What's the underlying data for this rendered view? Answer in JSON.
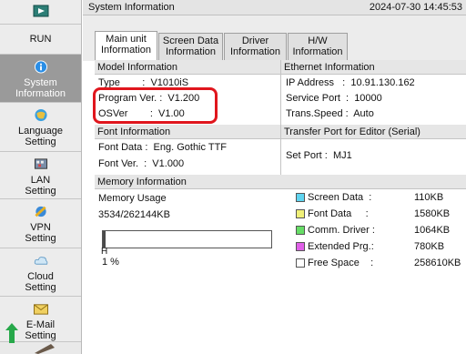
{
  "header": {
    "title": "System Information",
    "datetime": "2024-07-30 14:45:53"
  },
  "sidebar": {
    "items": [
      {
        "label": "",
        "icon": "top-screen-icon"
      },
      {
        "label": "RUN",
        "icon": ""
      },
      {
        "label": "System\nInformation",
        "icon": "info-icon"
      },
      {
        "label": "Language\nSetting",
        "icon": "language-icon"
      },
      {
        "label": "LAN\nSetting",
        "icon": "lan-icon"
      },
      {
        "label": "VPN\nSetting",
        "icon": "vpn-icon"
      },
      {
        "label": "Cloud\nSetting",
        "icon": "cloud-icon"
      },
      {
        "label": "E-Mail\nSetting",
        "icon": "email-icon"
      }
    ]
  },
  "tabs": [
    {
      "label": "Main unit\nInformation",
      "active": true
    },
    {
      "label": "Screen Data\nInformation",
      "active": false
    },
    {
      "label": "Driver\nInformation",
      "active": false
    },
    {
      "label": "H/W\nInformation",
      "active": false
    }
  ],
  "model": {
    "heading": "Model Information",
    "type": "Type        :  V1010iS",
    "program": "Program Ver. :  V1.200",
    "os": "OSVer        :  V1.00"
  },
  "ethernet": {
    "heading": "Ethernet Information",
    "ip": "IP Address   :  10.91.130.162",
    "port": "Service Port  :  10000",
    "speed": "Trans.Speed :  Auto"
  },
  "font": {
    "heading": "Font Information",
    "data": "Font Data :  Eng. Gothic TTF",
    "ver": "Font Ver.  :  V1.000"
  },
  "transfer": {
    "heading": "Transfer Port for Editor (Serial)",
    "port": "Set Port :  MJ1"
  },
  "memory": {
    "heading": "Memory Information",
    "usage_label": "Memory Usage",
    "usage_value": "3534/262144KB",
    "usage_fraction": 0.013,
    "bar_tick": "H",
    "percent": "1 %",
    "legend": [
      {
        "label": "Screen Data  :",
        "value": "110KB",
        "color": "#5fd4f0"
      },
      {
        "label": "Font Data     :",
        "value": "1580KB",
        "color": "#f0f078"
      },
      {
        "label": "Comm. Driver :",
        "value": "1064KB",
        "color": "#66dd66"
      },
      {
        "label": "Extended Prg.:",
        "value": "780KB",
        "color": "#e060e8"
      },
      {
        "label": "Free Space    :",
        "value": "258610KB",
        "color": "#ffffff"
      }
    ]
  },
  "colors": {
    "highlight": "#e0161d",
    "active_sidebar": "#9a9a9a"
  }
}
